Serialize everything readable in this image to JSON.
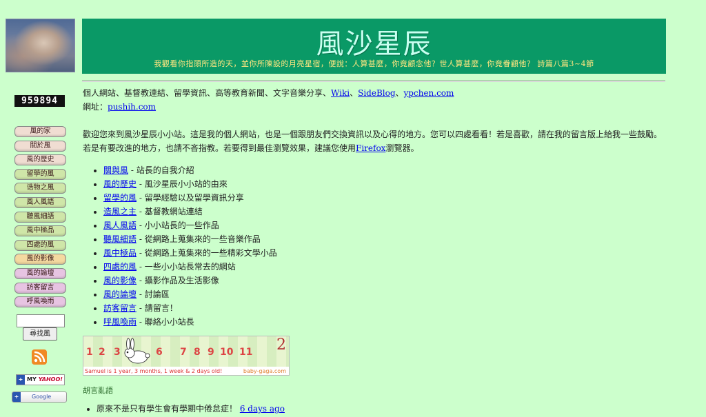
{
  "counter": "959894",
  "nav": [
    {
      "label": "風的家",
      "color": "#f0ddd2"
    },
    {
      "label": "關於風",
      "color": "#f0ddd2"
    },
    {
      "label": "風的歷史",
      "color": "#f0ddd2"
    },
    {
      "label": "留學的風",
      "color": "#cfe6a8"
    },
    {
      "label": "诰物之風",
      "color": "#cfe6a8"
    },
    {
      "label": "風人風語",
      "color": "#cfe6a8"
    },
    {
      "label": "聽風細語",
      "color": "#cfe6a8"
    },
    {
      "label": "風中極品",
      "color": "#cfe6a8"
    },
    {
      "label": "四處的風",
      "color": "#cfe6a8"
    },
    {
      "label": "風的影像",
      "color": "#f4d9a0"
    },
    {
      "label": "風的論壇",
      "color": "#e7c4e2"
    },
    {
      "label": "訪客留言",
      "color": "#e7c4e2"
    },
    {
      "label": "呼風喚雨",
      "color": "#e7c4e2"
    }
  ],
  "search": {
    "button_label": "尋找風"
  },
  "badges": {
    "my": "MY",
    "yahoo": "YAHOO!",
    "google": "Google"
  },
  "header": {
    "title": "風沙星辰",
    "verse": "我觀看你指頭所造的天，並你所陳設的月亮星宿，便說：人算甚麼，你竟顧念他？世人算甚麼，你竟眷顧他？ 詩篇八篇3~4節"
  },
  "main": {
    "links_prefix": "個人網站、基督教連結、留學資訊、高等教育新聞、文字音樂分享、",
    "links": [
      "Wiki",
      "SideBlog",
      "ypchen.com"
    ],
    "url_label": "網址：",
    "url_link": "pushih.com",
    "welcome_a": "歡迎您來到風沙星辰小小站。這是我的個人網站，也是一個跟朋友們交換資訊以及心得的地方。您可以四處看看！若是喜歡，請在我的留言版上給我一些鼓勵。若是有要改進的地方，也請不吝指教。若要得到最佳瀏覽效果，建議您使用",
    "welcome_link": "Firefox",
    "welcome_b": "瀏覽器。",
    "menu": [
      {
        "link": "關與風",
        "desc": " - 站長的自我介紹"
      },
      {
        "link": "風的歷史",
        "desc": " - 風沙星辰小小站的由來"
      },
      {
        "link": "留學的風",
        "desc": " - 留學經驗以及留學資訊分享"
      },
      {
        "link": "造風之主",
        "desc": " - 基督教網站連結"
      },
      {
        "link": "風人風語",
        "desc": " - 小小站長的一些作品"
      },
      {
        "link": "聽風細語",
        "desc": " - 從網路上蒐集來的一些音樂作品"
      },
      {
        "link": "風中極品",
        "desc": " - 從網路上蒐集來的一些精彩文學小品"
      },
      {
        "link": "四處的風",
        "desc": " - 一些小小站長常去的網站"
      },
      {
        "link": "風的影像",
        "desc": " - 攝影作品及生活影像"
      },
      {
        "link": "風的論壇",
        "desc": " - 討論區"
      },
      {
        "link": "訪客留言",
        "desc": " - 請留言！"
      },
      {
        "link": "呼風喚雨",
        "desc": " - 聯絡小小站長"
      }
    ],
    "birthday": {
      "numbers": [
        "1",
        "2",
        "3",
        "6",
        "7",
        "8",
        "9",
        "10",
        "11"
      ],
      "age": "2",
      "caption": "Samuel is 1 year, 3 months, 1 week & 2 days old!",
      "site": "baby-gaga.com"
    },
    "blog_title": "胡言亂語",
    "blog_items": [
      {
        "text": "原來不是只有學生會有學期中倦怠症！ ",
        "link": "6 days ago"
      }
    ]
  }
}
